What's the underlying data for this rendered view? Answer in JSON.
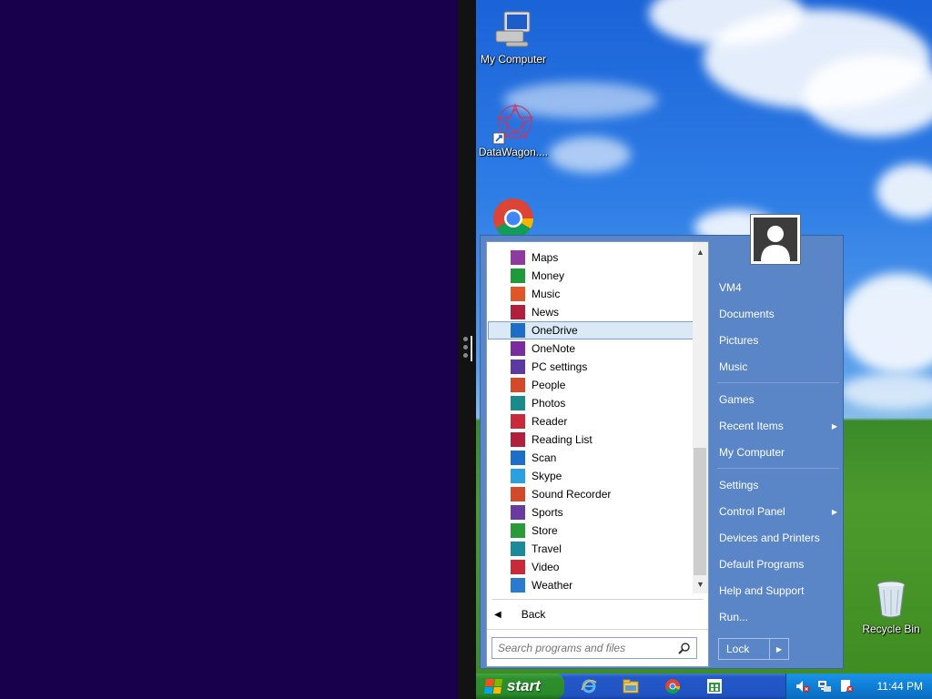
{
  "desktop": {
    "icons": [
      {
        "label": "My Computer"
      },
      {
        "label": "DataWagon...."
      },
      {
        "label": ""
      },
      {
        "label": "Recycle Bin"
      }
    ]
  },
  "start_menu": {
    "programs": [
      {
        "label": "Maps",
        "icon": "maps-icon",
        "color": "#8e3aa0"
      },
      {
        "label": "Money",
        "icon": "money-icon",
        "color": "#1e9a3a"
      },
      {
        "label": "Music",
        "icon": "music-icon",
        "color": "#e0562a"
      },
      {
        "label": "News",
        "icon": "news-icon",
        "color": "#b0203a"
      },
      {
        "label": "OneDrive",
        "icon": "onedrive-icon",
        "color": "#1e6ec8"
      },
      {
        "label": "OneNote",
        "icon": "onenote-icon",
        "color": "#7b2c9c"
      },
      {
        "label": "PC settings",
        "icon": "pc-settings-icon",
        "color": "#5a3aa0"
      },
      {
        "label": "People",
        "icon": "people-icon",
        "color": "#d24a2a"
      },
      {
        "label": "Photos",
        "icon": "photos-icon",
        "color": "#1a8a8a"
      },
      {
        "label": "Reader",
        "icon": "reader-icon",
        "color": "#c82a3a"
      },
      {
        "label": "Reading List",
        "icon": "reading-list-icon",
        "color": "#b0203a"
      },
      {
        "label": "Scan",
        "icon": "scan-icon",
        "color": "#1e6ec8"
      },
      {
        "label": "Skype",
        "icon": "skype-icon",
        "color": "#2aa0e0"
      },
      {
        "label": "Sound Recorder",
        "icon": "sound-recorder-icon",
        "color": "#d24a2a"
      },
      {
        "label": "Sports",
        "icon": "sports-icon",
        "color": "#6a3aa0"
      },
      {
        "label": "Store",
        "icon": "store-icon",
        "color": "#2a9a3a"
      },
      {
        "label": "Travel",
        "icon": "travel-icon",
        "color": "#1a8a9a"
      },
      {
        "label": "Video",
        "icon": "video-icon",
        "color": "#c82a3a"
      },
      {
        "label": "Weather",
        "icon": "weather-icon",
        "color": "#2a7ad0"
      }
    ],
    "selected": "OneDrive",
    "back_label": "Back",
    "search_placeholder": "Search programs and files",
    "right_items": [
      {
        "label": "VM4"
      },
      {
        "label": "Documents"
      },
      {
        "label": "Pictures"
      },
      {
        "label": "Music"
      },
      {
        "label": "Games"
      },
      {
        "label": "Recent Items",
        "submenu": true
      },
      {
        "label": "My Computer"
      },
      {
        "label": "Settings"
      },
      {
        "label": "Control Panel",
        "submenu": true
      },
      {
        "label": "Devices and Printers"
      },
      {
        "label": "Default Programs"
      },
      {
        "label": "Help and Support"
      },
      {
        "label": "Run..."
      }
    ],
    "lock_label": "Lock"
  },
  "taskbar": {
    "start_label": "start",
    "clock": "11:44 PM"
  },
  "colors": {
    "menu_blue": "#5a86c8",
    "taskbar_blue": "#2458c8",
    "start_green": "#2f8f2f"
  }
}
